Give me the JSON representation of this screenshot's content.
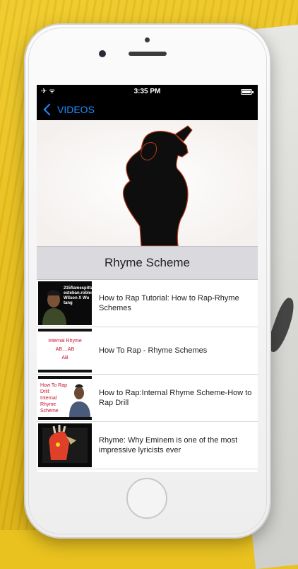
{
  "status_bar": {
    "time": "3:35 PM",
    "left_icons": "✈ ᯤ"
  },
  "nav": {
    "back_label": "VIDEOS"
  },
  "section": {
    "title": "Rhyme Scheme"
  },
  "videos": [
    {
      "title": "How to Rap Tutorial: How to Rap-Rhyme Schemes",
      "thumb_text": "215flamespitta\nesteban.robles\nWilson X Wu tang"
    },
    {
      "title": "How To Rap - Rhyme Schemes",
      "thumb_text": "Internal Rhyme\nAB....AB\nAB"
    },
    {
      "title": "How to Rap:Internal Rhyme Scheme-How to Rap Drill",
      "thumb_text": "How To Rap Drill:\nInternal\nRhyme\nScheme"
    },
    {
      "title": "Rhyme: Why Eminem is one of the most impressive lyricists ever",
      "thumb_text": ""
    }
  ],
  "colors": {
    "accent": "#1f8eff",
    "nav_bg": "#000000",
    "section_bg": "#d9d9de",
    "thumb2_text": "#c8102e"
  }
}
